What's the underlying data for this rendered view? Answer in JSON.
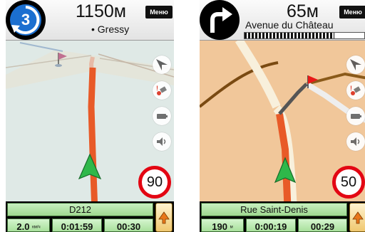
{
  "screens": {
    "left": {
      "maneuver_icon": "roundabout-exit-3-icon",
      "roundabout_exit": "3",
      "distance": "1150м",
      "next_street": "• Gressy",
      "menu_label": "Меню",
      "speed_limit": "90",
      "current_street": "D212",
      "info": {
        "speed": "2.0",
        "speed_unit": "км/ч",
        "time_remaining": "0:01:59",
        "arrival": "00:30"
      },
      "map_background": "#dfe9e6",
      "route_color": "#e85a28"
    },
    "right": {
      "maneuver_icon": "turn-right-icon",
      "distance": "65м",
      "next_street": "Avenue du Château",
      "menu_label": "Меню",
      "progress": 0.75,
      "speed_limit": "50",
      "current_street": "Rue Saint-Denis",
      "info": {
        "speed": "190",
        "speed_unit": "м",
        "time_remaining": "0:00:19",
        "arrival": "00:29"
      },
      "map_background": "#f1c79a",
      "route_color": "#e85a28"
    }
  },
  "icons": [
    "compass-icon",
    "satellite-gps-icon",
    "battery-icon",
    "speaker-icon",
    "destination-flag-icon",
    "vehicle-arrow-icon",
    "navigation-arrow-icon"
  ],
  "colors": {
    "speed_sign_border": "#e30613",
    "info_panel": "#a8e09b",
    "nav_button": "#f0c870"
  }
}
